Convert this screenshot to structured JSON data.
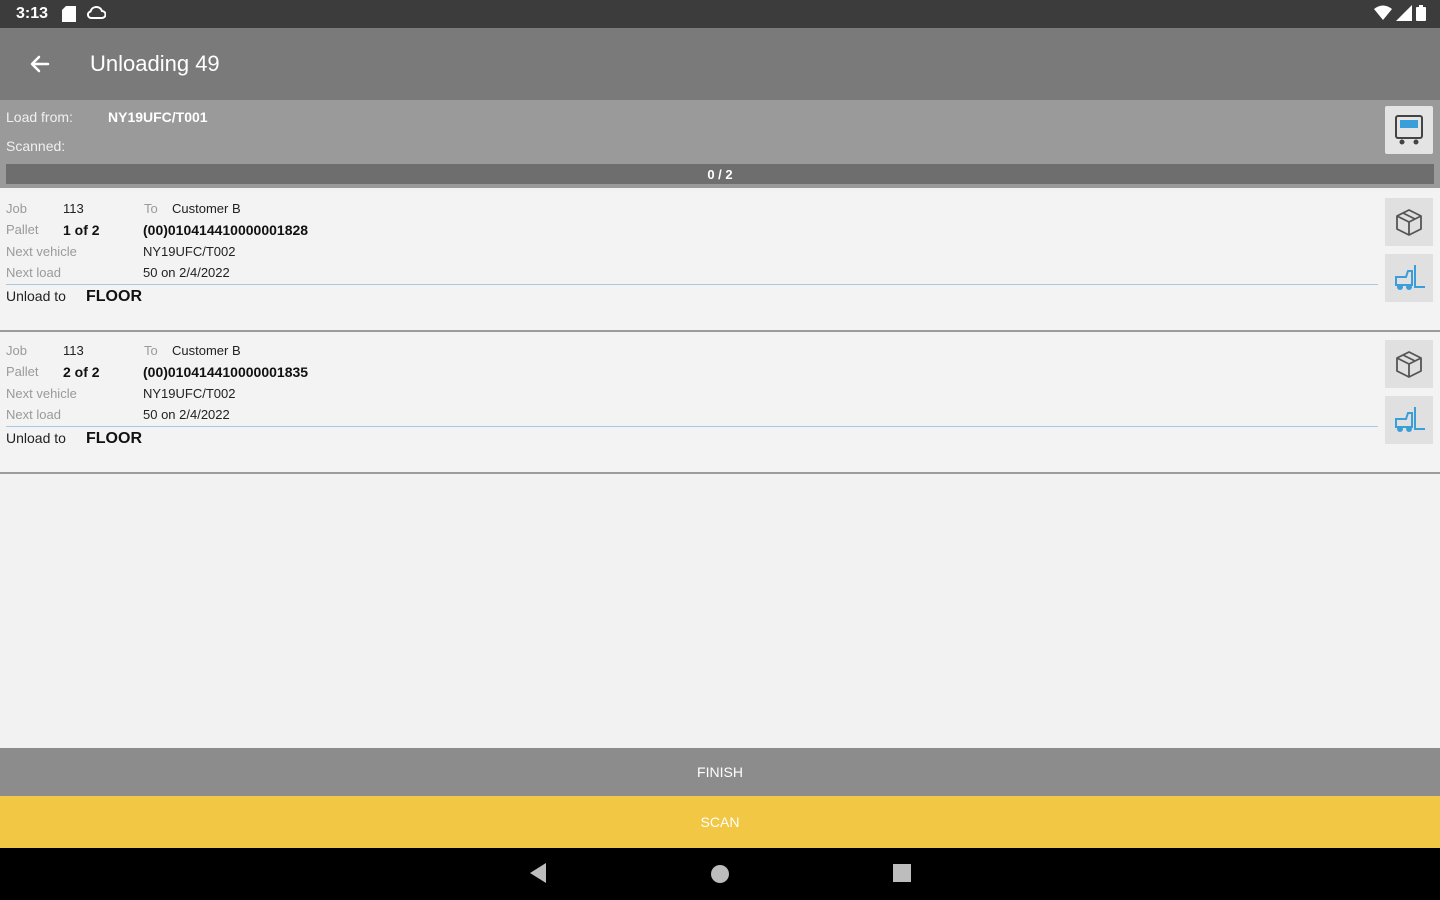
{
  "status_bar": {
    "time": "3:13",
    "icons": [
      "sd-card-icon",
      "cloud-icon",
      "wifi-icon",
      "signal-icon",
      "battery-icon"
    ]
  },
  "app_bar": {
    "title": "Unloading 49",
    "back_icon": "arrow-back-icon"
  },
  "header": {
    "load_from_label": "Load from:",
    "load_from_value": "NY19UFC/T001",
    "scanned_label": "Scanned:",
    "progress_text": "0 / 2",
    "progress_fraction": 0,
    "truck_icon": "truck-icon"
  },
  "pallets": [
    {
      "job_label": "Job",
      "job_value": "113",
      "to_label": "To",
      "to_value": "Customer B",
      "pallet_label": "Pallet",
      "pallet_value": "1 of 2",
      "barcode": "(00)010414410000001828",
      "next_vehicle_label": "Next vehicle",
      "next_vehicle_value": "NY19UFC/T002",
      "next_load_label": "Next load",
      "next_load_value": "50 on 2/4/2022",
      "unload_to_label": "Unload to",
      "unload_to_value": "FLOOR"
    },
    {
      "job_label": "Job",
      "job_value": "113",
      "to_label": "To",
      "to_value": "Customer B",
      "pallet_label": "Pallet",
      "pallet_value": "2 of 2",
      "barcode": "(00)010414410000001835",
      "next_vehicle_label": "Next vehicle",
      "next_vehicle_value": "NY19UFC/T002",
      "next_load_label": "Next load",
      "next_load_value": "50 on 2/4/2022",
      "unload_to_label": "Unload to",
      "unload_to_value": "FLOOR"
    }
  ],
  "buttons": {
    "finish": "FINISH",
    "scan": "SCAN"
  },
  "colors": {
    "accent": "#f2c744",
    "forklift": "#3a9fd8"
  }
}
